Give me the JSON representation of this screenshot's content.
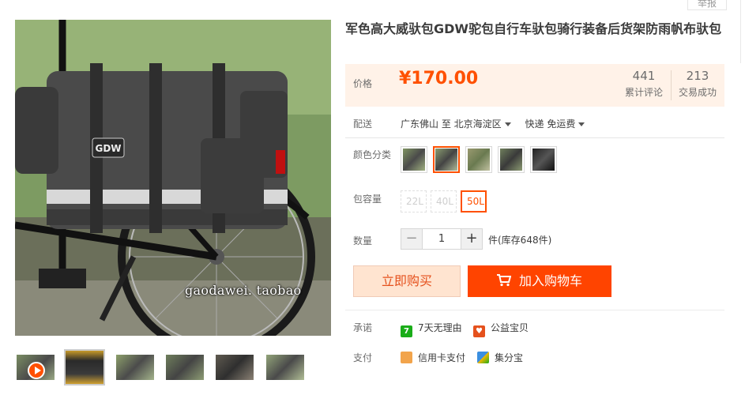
{
  "header": {
    "report_label": "举报"
  },
  "product": {
    "title": "军色高大威驮包GDW驼包自行车驮包骑行装备后货架防雨帆布驮包",
    "main_image_watermark": "gaodawei. taobao",
    "thumbnails": [
      {
        "label": "",
        "has_play": true,
        "selected": false
      },
      {
        "label": "",
        "has_play": false,
        "selected": true
      },
      {
        "label": "",
        "has_play": false,
        "selected": false
      },
      {
        "label": "",
        "has_play": false,
        "selected": false
      },
      {
        "label": "",
        "has_play": false,
        "selected": false
      },
      {
        "label": "",
        "has_play": false,
        "selected": false
      }
    ]
  },
  "price": {
    "label": "价格",
    "value": "¥170.00",
    "reviews_count": "441",
    "reviews_label": "累计评论",
    "sales_count": "213",
    "sales_label": "交易成功"
  },
  "delivery": {
    "label": "配送",
    "from": "广东佛山 至",
    "to": "北京海淀区",
    "shipping": "快递 免运费"
  },
  "color": {
    "label": "颜色分类",
    "options_count": 5,
    "selected_index": 1
  },
  "capacity": {
    "label": "包容量",
    "options": [
      "22L",
      "40L",
      "50L"
    ],
    "selected": "50L"
  },
  "quantity": {
    "label": "数量",
    "minus": "−",
    "plus": "+",
    "value": "1",
    "stock_text": "件(库存648件)"
  },
  "actions": {
    "buy_now": "立即购买",
    "add_to_cart": "加入购物车"
  },
  "promise": {
    "label": "承诺",
    "items": [
      {
        "icon": "7",
        "text": "7天无理由",
        "color": "#1aad19"
      },
      {
        "icon": "♥",
        "text": "公益宝贝",
        "color": "#e5511d"
      }
    ]
  },
  "payment": {
    "label": "支付",
    "items": [
      {
        "text": "信用卡支付",
        "color": "#f2a44b"
      },
      {
        "text": "集分宝",
        "color": "#3b8fe0"
      }
    ]
  },
  "colors": {
    "accent": "#ff5000",
    "cart_bg": "#ff4400",
    "buy_bg": "#ffe4d0",
    "price_bg": "#fff2e8"
  }
}
